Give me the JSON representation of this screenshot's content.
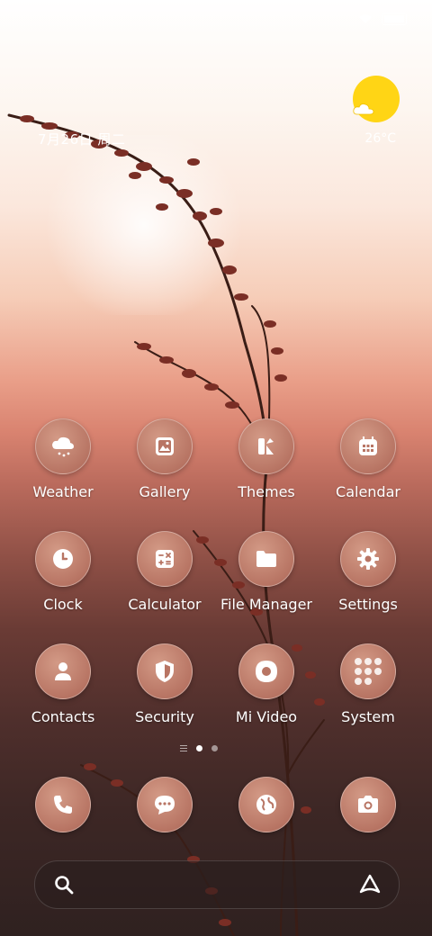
{
  "status_bar": {
    "icons": [
      "wifi-icon",
      "battery-icon"
    ]
  },
  "widget": {
    "date": "7月26日 周二",
    "temperature": "26°C",
    "weather_icon": "partly-sunny-icon",
    "sun_color": "#ffd515"
  },
  "apps": [
    {
      "label": "Weather",
      "icon": "cloud-rain-icon"
    },
    {
      "label": "Gallery",
      "icon": "image-icon"
    },
    {
      "label": "Themes",
      "icon": "themes-icon"
    },
    {
      "label": "Calendar",
      "icon": "calendar-icon"
    },
    {
      "label": "Clock",
      "icon": "clock-icon"
    },
    {
      "label": "Calculator",
      "icon": "calculator-icon"
    },
    {
      "label": "File Manager",
      "icon": "folder-icon"
    },
    {
      "label": "Settings",
      "icon": "gear-icon"
    },
    {
      "label": "Contacts",
      "icon": "person-icon"
    },
    {
      "label": "Security",
      "icon": "shield-icon"
    },
    {
      "label": "Mi Video",
      "icon": "play-icon"
    },
    {
      "label": "System",
      "icon": "app-folder-icon"
    }
  ],
  "page_indicator": {
    "pages": 2,
    "active": 1
  },
  "dock": [
    {
      "icon": "phone-icon"
    },
    {
      "icon": "message-icon"
    },
    {
      "icon": "browser-globe-icon"
    },
    {
      "icon": "camera-icon"
    }
  ],
  "search_bar": {
    "left_icon": "search-icon",
    "right_icon": "assistant-icon"
  },
  "colors": {
    "icon_bg": "#b87564",
    "accent_sun": "#ffd515"
  }
}
